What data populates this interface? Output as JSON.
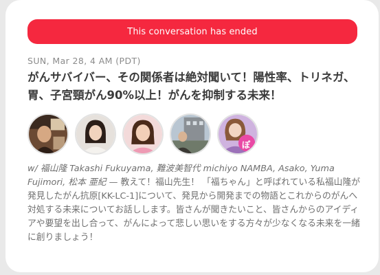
{
  "banner": {
    "text": "This conversation has ended",
    "color": "#f5283f"
  },
  "event": {
    "datetime": "SUN, Mar 28, 4 AM (PDT)",
    "title": "がんサバイバー、その関係者は絶対聞いて！陽性率、トリネガ、胃、子宮頸がん90%以上！がんを抑制する未来！",
    "members_text": "w/ 福山隆 Takashi Fukuyama, 難波美智代 michiyo NAMBA, Asako, Yuma Fujimori, 松本 亜紀",
    "separator": " — ",
    "description": "教えて！福山先生！ 「福ちゃん」と呼ばれている私福山隆が発見したがん抗原[KK-LC-1]について、発見から開発までの物語とこれからのがんへ対処する未来についてお話しします。皆さんが聞きたいこと、皆さんからのアイディアや要望を出し合って、がんによって悲しい思いをする方々が少なくなる未来を一緒に創りましょう！"
  },
  "avatars": [
    {
      "name": "avatar-1",
      "colors": [
        "#5a3b2a",
        "#c9a27c"
      ]
    },
    {
      "name": "avatar-2",
      "colors": [
        "#d9d2cc",
        "#2a1f1a"
      ]
    },
    {
      "name": "avatar-3",
      "colors": [
        "#f0d6d6",
        "#3a2418"
      ]
    },
    {
      "name": "avatar-4",
      "colors": [
        "#9aa9b8",
        "#3d3a35"
      ]
    },
    {
      "name": "avatar-5",
      "colors": [
        "#c7a6d8",
        "#e94aa5"
      ],
      "badge_text": "ぽん"
    }
  ]
}
